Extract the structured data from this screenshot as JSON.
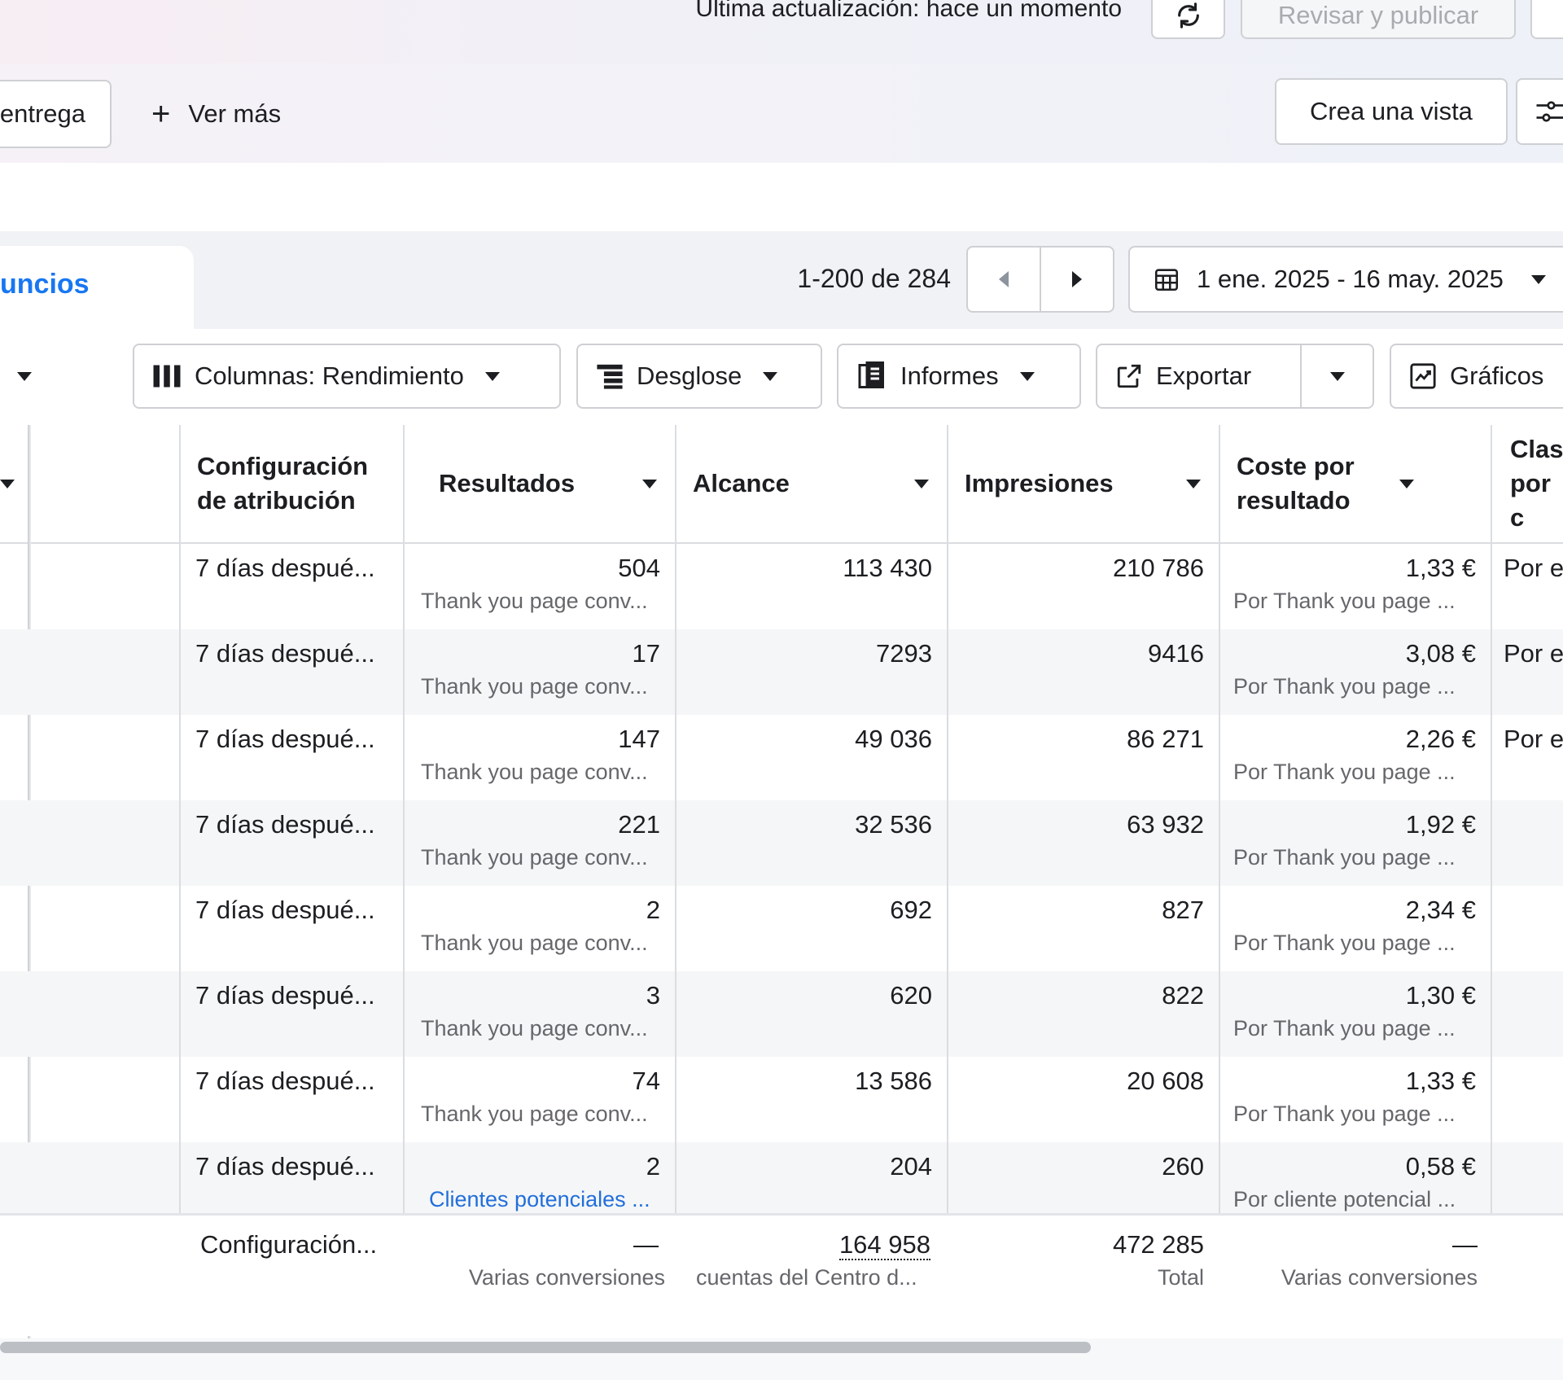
{
  "topbar": {
    "last_update": "Última actualización: hace un momento",
    "refresh_icon": "refresh-icon",
    "review_publish": "Revisar y publicar"
  },
  "secondbar": {
    "delivery_tab": "entrega",
    "see_more": "Ver más",
    "create_view": "Crea una vista",
    "filter_icon": "sliders-icon"
  },
  "tabs": {
    "active_tab": "uncios"
  },
  "pager": {
    "range_text": "1-200 de 284",
    "date_range": "1 ene. 2025 - 16 may. 2025"
  },
  "toolbar": {
    "columns": "Columnas: Rendimiento",
    "breakdown": "Desglose",
    "reports": "Informes",
    "export": "Exportar",
    "charts": "Gráficos"
  },
  "table": {
    "headers": {
      "attribution": "Configuración de atribución",
      "results": "Resultados",
      "reach": "Alcance",
      "impressions": "Impresiones",
      "cost_per_result": "Coste por resultado",
      "class": "Clas por c"
    },
    "rows": [
      {
        "attribution": "7 días despué...",
        "results": "504",
        "results_sub": "Thank you page conv...",
        "reach": "113 430",
        "impressions": "210 786",
        "cost": "1,33 €",
        "cost_sub": "Por Thank you page ...",
        "class": "Por e"
      },
      {
        "attribution": "7 días despué...",
        "results": "17",
        "results_sub": "Thank you page conv...",
        "reach": "7293",
        "impressions": "9416",
        "cost": "3,08 €",
        "cost_sub": "Por Thank you page ...",
        "class": "Por e"
      },
      {
        "attribution": "7 días despué...",
        "results": "147",
        "results_sub": "Thank you page conv...",
        "reach": "49 036",
        "impressions": "86 271",
        "cost": "2,26 €",
        "cost_sub": "Por Thank you page ...",
        "class": "Por e"
      },
      {
        "attribution": "7 días despué...",
        "results": "221",
        "results_sub": "Thank you page conv...",
        "reach": "32 536",
        "impressions": "63 932",
        "cost": "1,92 €",
        "cost_sub": "Por Thank you page ...",
        "class": ""
      },
      {
        "attribution": "7 días despué...",
        "results": "2",
        "results_sub": "Thank you page conv...",
        "reach": "692",
        "impressions": "827",
        "cost": "2,34 €",
        "cost_sub": "Por Thank you page ...",
        "class": ""
      },
      {
        "attribution": "7 días despué...",
        "results": "3",
        "results_sub": "Thank you page conv...",
        "reach": "620",
        "impressions": "822",
        "cost": "1,30 €",
        "cost_sub": "Por Thank you page ...",
        "class": ""
      },
      {
        "attribution": "7 días despué...",
        "results": "74",
        "results_sub": "Thank you page conv...",
        "reach": "13 586",
        "impressions": "20 608",
        "cost": "1,33 €",
        "cost_sub": "Por Thank you page ...",
        "class": ""
      },
      {
        "attribution": "7 días despué...",
        "results": "2",
        "results_sub": "Clientes potenciales ...",
        "reach": "204",
        "impressions": "260",
        "cost": "0,58 €",
        "cost_sub": "Por cliente potencial ...",
        "class": ""
      }
    ],
    "footer": {
      "attribution": "Configuración...",
      "results": "—",
      "results_sub": "Varias conversiones",
      "reach": "164 958",
      "reach_sub": "cuentas del Centro d...",
      "impressions": "472 285",
      "impressions_sub": "Total",
      "cost": "—",
      "cost_sub": "Varias conversiones"
    }
  }
}
